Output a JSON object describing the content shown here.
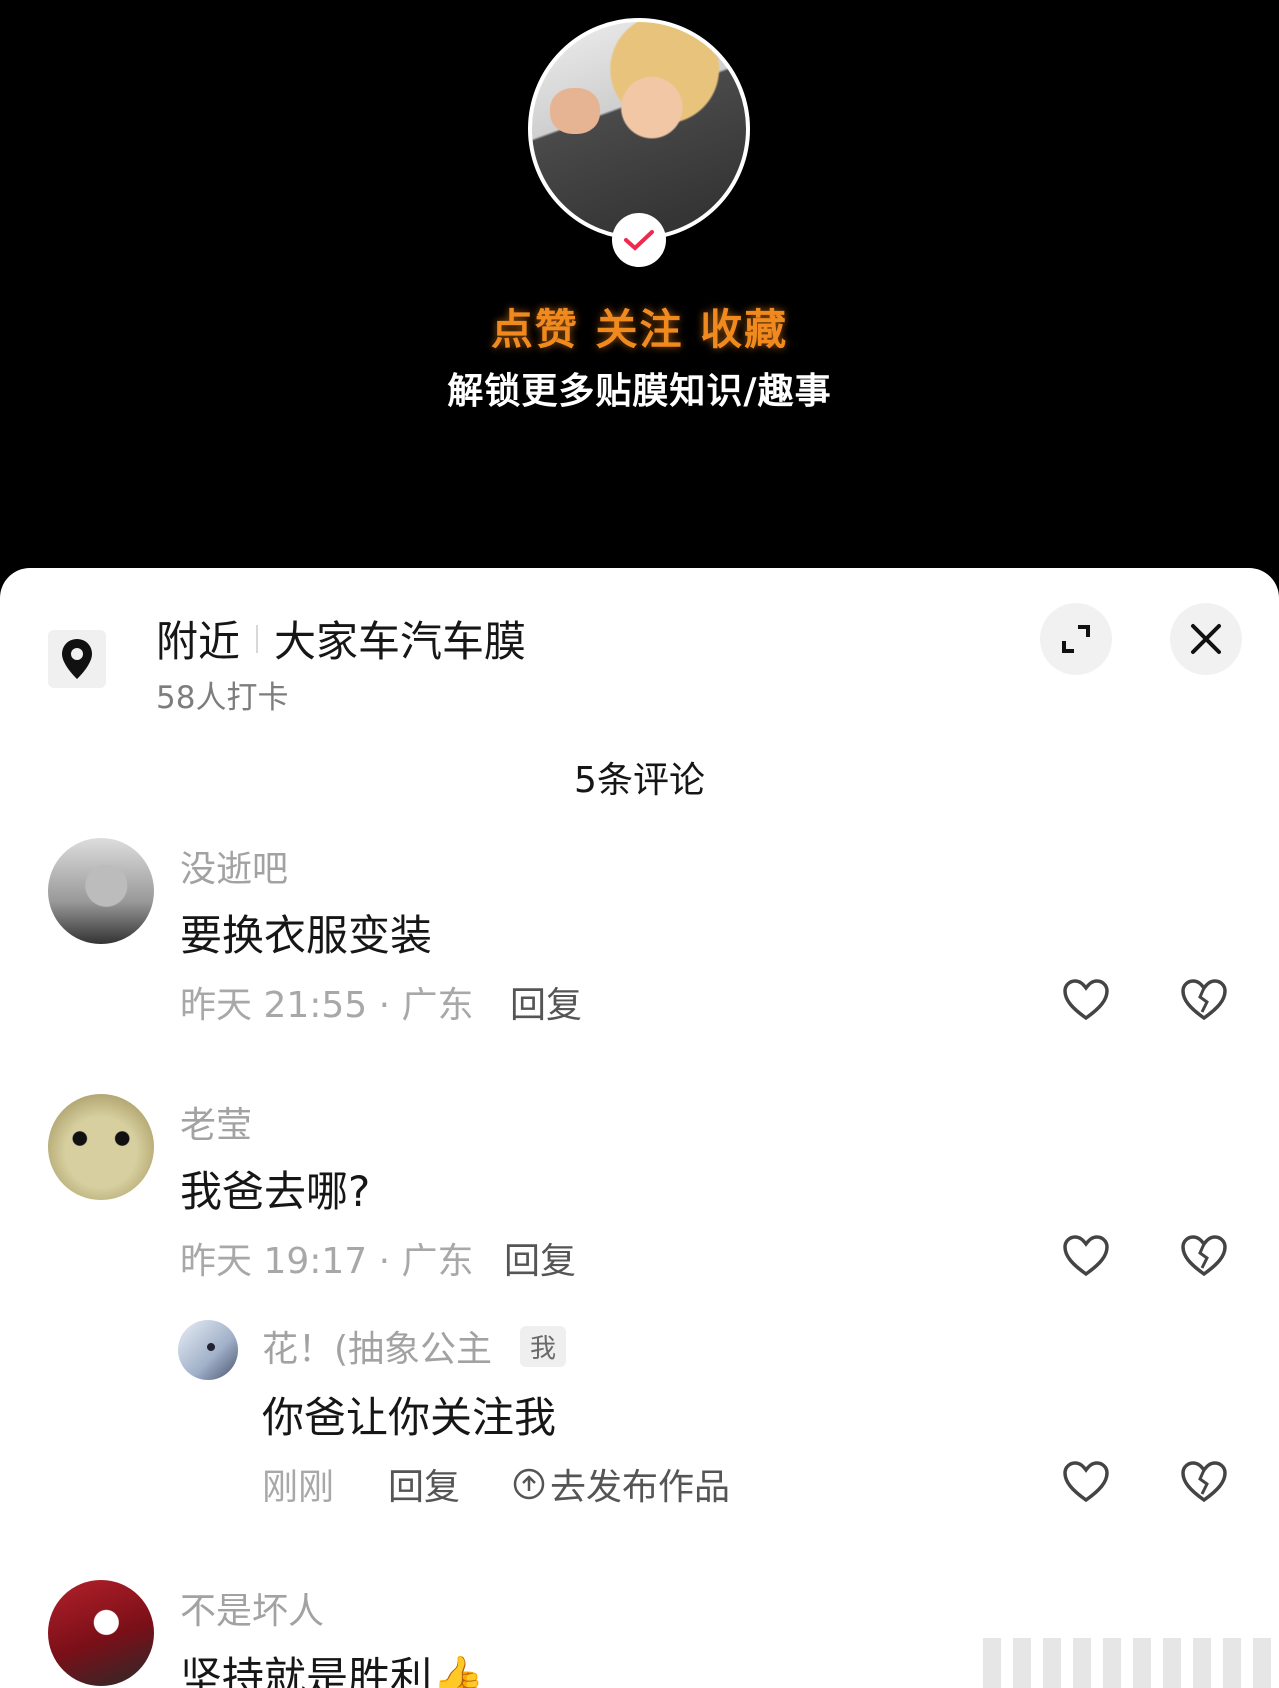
{
  "video": {
    "title_line1": "点赞 关注 收藏",
    "title_line2": "解锁更多贴膜知识/趣事"
  },
  "location": {
    "label": "附近",
    "name": "大家车汽车膜",
    "checkins": "58人打卡"
  },
  "comments_header": "5条评论",
  "comments": [
    {
      "user": "没逝吧",
      "text": "要换衣服变装",
      "meta": "昨天 21:55 · 广东",
      "reply_label": "回复"
    },
    {
      "user": "老莹",
      "text": "我爸去哪?",
      "meta": "昨天 19:17 · 广东",
      "reply_label": "回复"
    },
    {
      "user": "不是坏人",
      "text": "坚持就是胜利👍"
    }
  ],
  "reply": {
    "user": "花！(抽象公主",
    "me_tag": "我",
    "text": "你爸让你关注我",
    "meta": "刚刚",
    "reply_label": "回复",
    "publish_label": "去发布作品"
  },
  "colors": {
    "accent_orange": "#f08a1e",
    "verify_red": "#f0294f",
    "text_gray": "#a2a2a2"
  },
  "icons": [
    "location-pin-icon",
    "expand-icon",
    "close-icon",
    "heart-icon",
    "broken-heart-icon",
    "upload-icon",
    "check-icon"
  ]
}
